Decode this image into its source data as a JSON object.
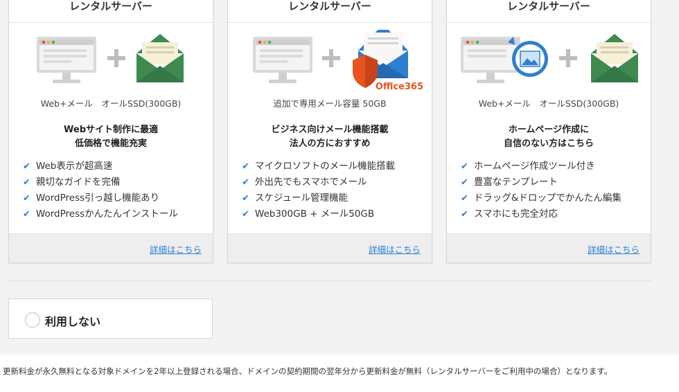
{
  "cards": [
    {
      "title": "レンタルサーバー",
      "spec": "Web+メール　オールSSD(300GB)",
      "catch1": "Webサイト制作に最適",
      "catch2": "低価格で機能充実",
      "features": [
        "Web表示が超高速",
        "親切なガイドを完備",
        "WordPress引っ越し機能あり",
        "WordPressかんたんインストール"
      ],
      "link": "詳細はこちら"
    },
    {
      "title": "レンタルサーバー",
      "badge": "Office365",
      "spec": "追加で専用メール容量 50GB",
      "catch1": "ビジネス向けメール機能搭載",
      "catch2": "法人の方におすすめ",
      "features": [
        "マイクロソフトのメール機能搭載",
        "外出先でもスマホでメール",
        "スケジュール管理機能",
        "Web300GB + メール50GB"
      ],
      "link": "詳細はこちら"
    },
    {
      "title": "レンタルサーバー",
      "spec": "Web+メール　オールSSD(300GB)",
      "catch1": "ホームページ作成に",
      "catch2": "自信のない方はこちら",
      "features": [
        "ホームページ作成ツール付き",
        "豊富なテンプレート",
        "ドラッグ&ドロップでかんたん編集",
        "スマホにも完全対応"
      ],
      "link": "詳細はこちら"
    }
  ],
  "icons": {
    "check": "checkmark-icon",
    "plus": "plus-icon"
  },
  "colors": {
    "accent": "#2a7fd4",
    "office": "#e8541f",
    "mail_green": "#3f8a4f",
    "mail_blue": "#2f7fd0"
  },
  "no_use": {
    "label": "利用しない"
  },
  "note": "更新料金が永久無料となる対象ドメインを2年以上登録される場合、ドメインの契約期間の翌年分から更新料金が無料（レンタルサーバーをご利用中の場合）となります。"
}
